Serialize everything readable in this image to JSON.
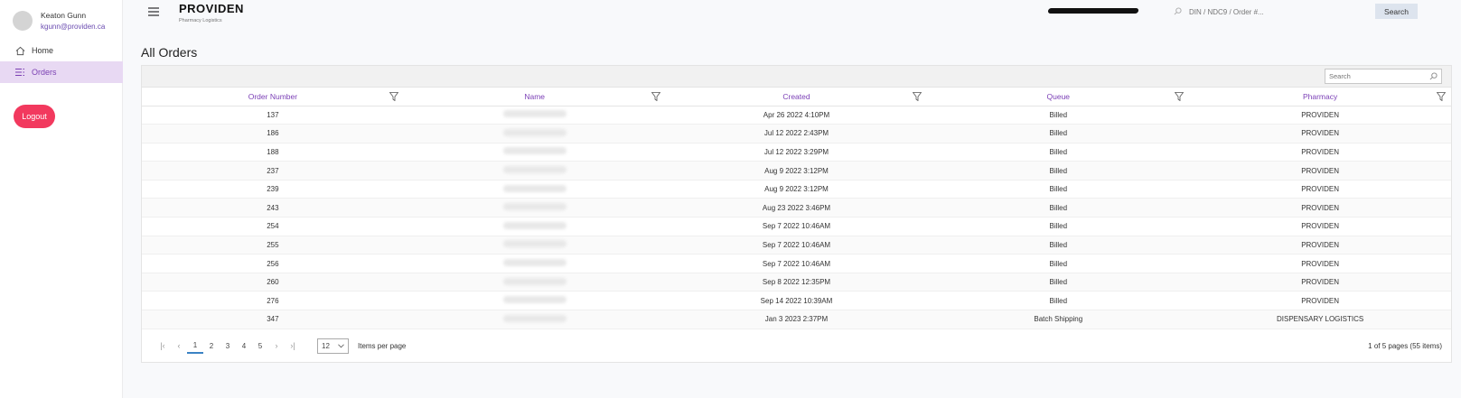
{
  "user": {
    "name": "Keaton Gunn",
    "email": "kgunn@providen.ca"
  },
  "nav": [
    {
      "label": "Home",
      "icon": "home-icon"
    },
    {
      "label": "Orders",
      "icon": "list-icon",
      "active": true
    }
  ],
  "logout_label": "Logout",
  "brand": {
    "name": "PROVIDEN",
    "subtitle": "Pharmacy Logistics"
  },
  "search": {
    "placeholder": "DIN / NDC9 / Order #...",
    "button": "Search"
  },
  "page_title": "All Orders",
  "grid": {
    "search_placeholder": "Search",
    "columns": [
      "Order Number",
      "Name",
      "Created",
      "Queue",
      "Pharmacy"
    ],
    "rows": [
      {
        "order": "137",
        "created": "Apr 26 2022 4:10PM",
        "queue": "Billed",
        "pharmacy": "PROVIDEN"
      },
      {
        "order": "186",
        "created": "Jul 12 2022 2:43PM",
        "queue": "Billed",
        "pharmacy": "PROVIDEN"
      },
      {
        "order": "188",
        "created": "Jul 12 2022 3:29PM",
        "queue": "Billed",
        "pharmacy": "PROVIDEN"
      },
      {
        "order": "237",
        "created": "Aug 9 2022 3:12PM",
        "queue": "Billed",
        "pharmacy": "PROVIDEN"
      },
      {
        "order": "239",
        "created": "Aug 9 2022 3:12PM",
        "queue": "Billed",
        "pharmacy": "PROVIDEN"
      },
      {
        "order": "243",
        "created": "Aug 23 2022 3:46PM",
        "queue": "Billed",
        "pharmacy": "PROVIDEN"
      },
      {
        "order": "254",
        "created": "Sep 7 2022 10:46AM",
        "queue": "Billed",
        "pharmacy": "PROVIDEN"
      },
      {
        "order": "255",
        "created": "Sep 7 2022 10:46AM",
        "queue": "Billed",
        "pharmacy": "PROVIDEN"
      },
      {
        "order": "256",
        "created": "Sep 7 2022 10:46AM",
        "queue": "Billed",
        "pharmacy": "PROVIDEN"
      },
      {
        "order": "260",
        "created": "Sep 8 2022 12:35PM",
        "queue": "Billed",
        "pharmacy": "PROVIDEN"
      },
      {
        "order": "276",
        "created": "Sep 14 2022 10:39AM",
        "queue": "Billed",
        "pharmacy": "PROVIDEN"
      },
      {
        "order": "347",
        "created": "Jan 3 2023 2:37PM",
        "queue": "Batch Shipping",
        "pharmacy": "DISPENSARY LOGISTICS"
      }
    ]
  },
  "pager": {
    "pages": [
      "1",
      "2",
      "3",
      "4",
      "5"
    ],
    "current": "1",
    "per_page": "12",
    "per_page_label": "Items per page",
    "info": "1 of 5 pages (55 items)"
  }
}
